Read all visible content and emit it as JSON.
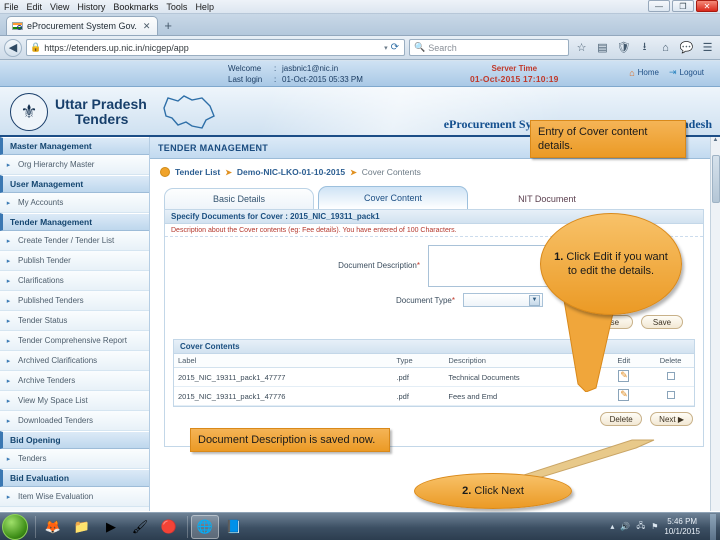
{
  "browser": {
    "menu": [
      "File",
      "Edit",
      "View",
      "History",
      "Bookmarks",
      "Tools",
      "Help"
    ],
    "window_controls": {
      "minimize": "—",
      "maximize": "❐",
      "close": "✕"
    },
    "tab_title": "eProcurement System Gov.",
    "tab_close": "✕",
    "new_tab": "+",
    "url": "https://etenders.up.nic.in/nicgep/app",
    "search_placeholder": "Search",
    "back_arrow": "◀",
    "reload": "⟳",
    "url_caret": "▾"
  },
  "header": {
    "welcome_label": "Welcome",
    "welcome_value": "jasbnic1@nic.in",
    "lastlogin_label": "Last login",
    "lastlogin_value": "01-Oct-2015 05:33 PM",
    "separator": ":",
    "server_time_label": "Server Time",
    "server_time_value": "01-Oct-2015 17:10:19",
    "home_link": "Home",
    "logout_link": "Logout"
  },
  "banner": {
    "title_line1": "Uttar Pradesh",
    "title_line2": "Tenders",
    "subtitle": "eProcurement System Government of Uttar Pradesh"
  },
  "sidebar": {
    "groups": [
      {
        "label": "Master Management",
        "items": [
          "Org Hierarchy Master"
        ]
      },
      {
        "label": "User Management",
        "items": [
          "My Accounts"
        ]
      },
      {
        "label": "Tender Management",
        "items": [
          "Create Tender / Tender List",
          "Publish Tender",
          "Clarifications",
          "Published Tenders",
          "Tender Status",
          "Tender Comprehensive Report",
          "Archived Clarifications",
          "Archive Tenders",
          "View My Space List",
          "Downloaded Tenders"
        ]
      },
      {
        "label": "Bid Opening",
        "items": [
          "Tenders"
        ]
      },
      {
        "label": "Bid Evaluation",
        "items": [
          "Item Wise Evaluation"
        ]
      }
    ],
    "bullet": "▸"
  },
  "main": {
    "section_title": "TENDER MANAGEMENT",
    "breadcrumb": [
      "Tender List",
      "Demo-NIC-LKO-01-10-2015",
      "Cover Contents"
    ],
    "breadcrumb_arrow": "➤",
    "tabs": [
      {
        "label": "Basic Details",
        "active": false
      },
      {
        "label": "Cover Content",
        "active": true
      },
      {
        "label": "NIT Document",
        "active": false
      }
    ],
    "panel_title": "Specify Documents for Cover : 2015_NIC_19311_pack1",
    "panel_note": "Description about the Cover contents (eg: Fee details). You have entered  of 100 Characters.",
    "doc_description_label": "Document Description",
    "doc_description_value": "",
    "doc_type_label": "Document Type",
    "doc_type_value": "",
    "required_star": "*",
    "select_caret": "▼",
    "form_buttons": [
      "Use",
      "Save"
    ],
    "table": {
      "title": "Cover Contents",
      "columns": [
        "Label",
        "Type",
        "Description",
        "Edit",
        "Delete"
      ],
      "rows": [
        {
          "label": "2015_NIC_19311_pack1_47777",
          "type": ".pdf",
          "description": "Technical Documents"
        },
        {
          "label": "2015_NIC_19311_pack1_47776",
          "type": ".pdf",
          "description": "Fees and Emd"
        }
      ]
    },
    "bottom_buttons": [
      {
        "label": "Delete"
      },
      {
        "label": "Next ▶"
      }
    ]
  },
  "callouts": {
    "entry": "Entry of Cover content details.",
    "edit_num": "1.",
    "edit_text": " Click Edit if you want to edit the details.",
    "saved": "Document Description is saved now.",
    "next_num": "2.",
    "next_text": " Click Next"
  },
  "taskbar": {
    "time": "5:46 PM",
    "date": "10/1/2015",
    "tray_up": "▴",
    "icons": [
      "start-orb",
      "firefox",
      "explorer",
      "media-player",
      "paint",
      "opera",
      "browser",
      "word"
    ]
  }
}
